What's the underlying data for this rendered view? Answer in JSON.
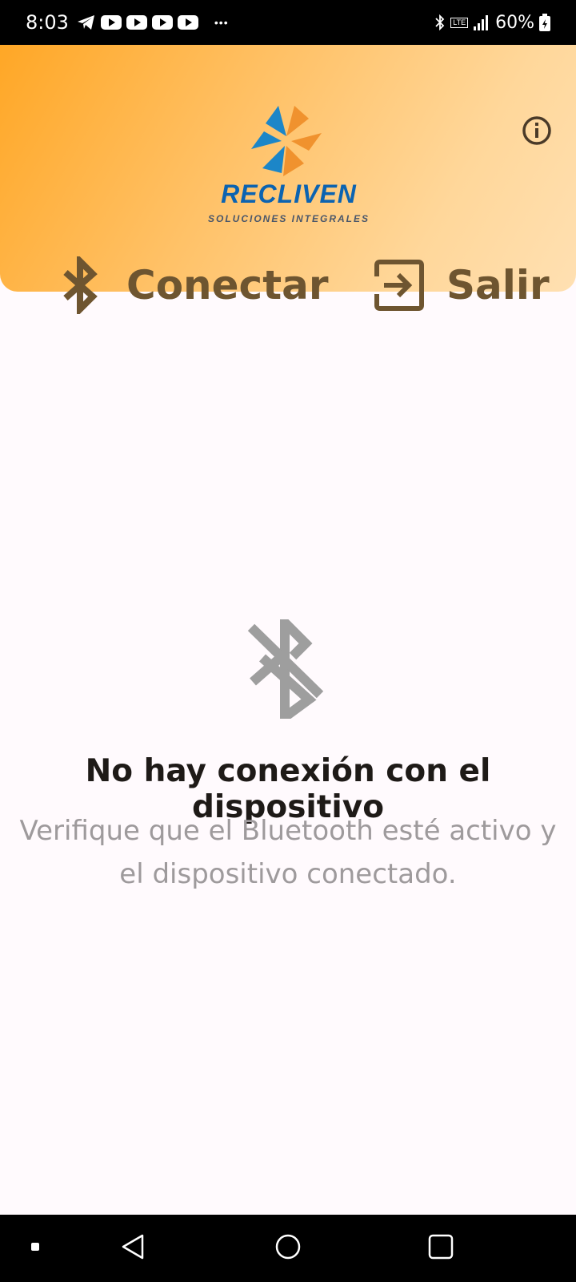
{
  "status_bar": {
    "time": "8:03",
    "battery": "60%",
    "network": "LTE",
    "icons": [
      "telegram-icon",
      "youtube-icon",
      "youtube-icon",
      "youtube-icon",
      "youtube-icon",
      "more-icon",
      "bluetooth-icon",
      "lte-icon",
      "signal-icon",
      "battery-icon"
    ]
  },
  "header": {
    "logo_name": "RECLIVEN",
    "logo_tagline": "SOLUCIONES INTEGRALES",
    "info_icon": "info-icon",
    "connect_label": "Conectar",
    "connect_icon": "bluetooth-icon",
    "exit_label": "Salir",
    "exit_icon": "exit-icon"
  },
  "main": {
    "empty_icon": "bluetooth-disabled-icon",
    "empty_title": "No hay conexión con el dispositivo",
    "empty_description": "Verifique que el Bluetooth esté activo y el dispositivo conectado."
  },
  "nav_bar": {
    "buttons": [
      "recent-indicator",
      "back-icon",
      "home-icon",
      "overview-icon"
    ]
  },
  "colors": {
    "header_gradient_start": "#ffa726",
    "header_gradient_end": "#ffe0b2",
    "action_text": "#6e5530",
    "logo_blue": "#0b63b1",
    "logo_orange": "#f0922e",
    "empty_icon": "#9e9e9e"
  }
}
